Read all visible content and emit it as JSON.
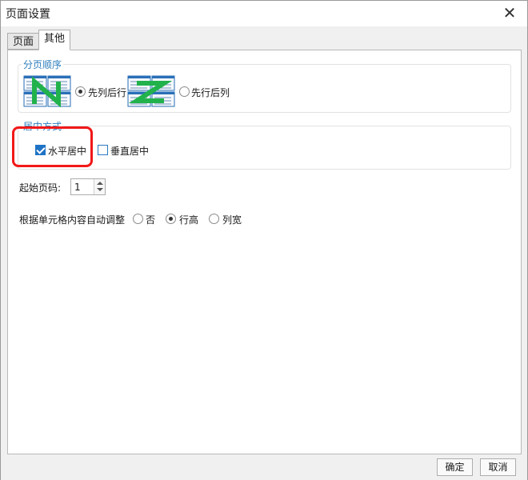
{
  "window": {
    "title": "页面设置"
  },
  "tabs": [
    {
      "label": "页面"
    },
    {
      "label": "其他"
    }
  ],
  "page_order": {
    "label": "分页顺序",
    "options": [
      {
        "label": "先列后行",
        "checked": true,
        "icon": "n-order-icon"
      },
      {
        "label": "先行后列",
        "checked": false,
        "icon": "z-order-icon"
      }
    ]
  },
  "centering": {
    "label": "居中方式",
    "options": [
      {
        "label": "水平居中",
        "checked": true
      },
      {
        "label": "垂直居中",
        "checked": false
      }
    ]
  },
  "start_page": {
    "label": "起始页码:",
    "value": "1"
  },
  "auto_adjust": {
    "label": "根据单元格内容自动调整",
    "options": [
      {
        "label": "否",
        "checked": false
      },
      {
        "label": "行高",
        "checked": true
      },
      {
        "label": "列宽",
        "checked": false
      }
    ]
  },
  "buttons": {
    "ok": "确定",
    "cancel": "取消"
  },
  "colors": {
    "accent": "#1f73c6",
    "group_label": "#2e7ebd",
    "highlight": "#f21818",
    "order_arrow": "#22b24c"
  }
}
